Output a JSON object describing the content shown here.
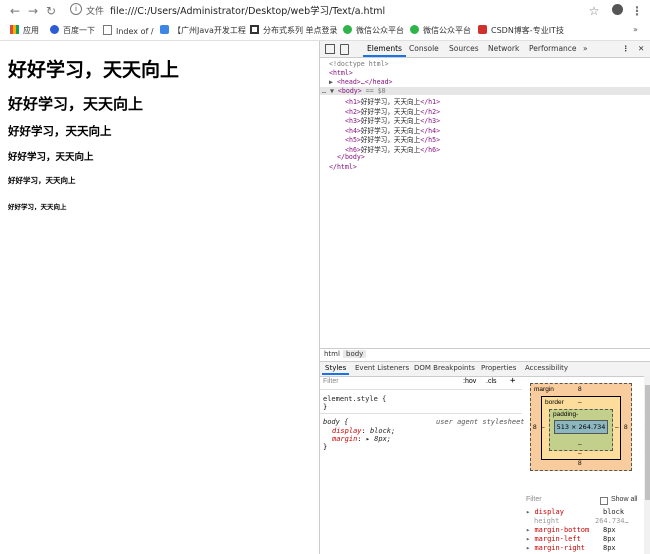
{
  "browser": {
    "url_prefix": "文件",
    "url": "file:///C:/Users/Administrator/Desktop/web学习/Text/a.html"
  },
  "bookmarks": [
    {
      "label": "应用",
      "icon": "apps-icon",
      "color": "#e04a3f"
    },
    {
      "label": "百度一下",
      "icon": "baidu-icon",
      "color": "#2d5bd6"
    },
    {
      "label": "Index of /",
      "icon": "page-icon",
      "color": "#777777"
    },
    {
      "label": "【广州Java开发工程",
      "icon": "hand-icon",
      "color": "#3b86e6"
    },
    {
      "label": "分布式系列 单点登录",
      "icon": "cnblogs-icon",
      "color": "#333333"
    },
    {
      "label": "微信公众平台",
      "icon": "wechat-icon",
      "color": "#2fb44a"
    },
    {
      "label": "微信公众平台",
      "icon": "wechat-icon",
      "color": "#2fb44a"
    },
    {
      "label": "CSDN博客-专业IT技",
      "icon": "csdn-icon",
      "color": "#d0312d"
    }
  ],
  "page": {
    "h1": "好好学习，天天向上",
    "h2": "好好学习，天天向上",
    "h3": "好好学习，天天向上",
    "h4": "好好学习，天天向上",
    "h5": "好好学习，天天向上",
    "h6": "好好学习，天天向上"
  },
  "devtools": {
    "tabs": [
      "Elements",
      "Console",
      "Sources",
      "Network",
      "Performance"
    ],
    "more": "»",
    "dom": {
      "doctype": "<!doctype html>",
      "html_open": "<html>",
      "head": "<head>…</head>",
      "body_open": "<body>",
      "body_marker": "== $0",
      "headings": [
        {
          "open": "<h1>",
          "text": "好好学习，天天向上",
          "close": "</h1>"
        },
        {
          "open": "<h2>",
          "text": "好好学习，天天向上",
          "close": "</h2>"
        },
        {
          "open": "<h3>",
          "text": "好好学习，天天向上",
          "close": "</h3>"
        },
        {
          "open": "<h4>",
          "text": "好好学习，天天向上",
          "close": "</h4>"
        },
        {
          "open": "<h5>",
          "text": "好好学习，天天向上",
          "close": "</h5>"
        },
        {
          "open": "<h6>",
          "text": "好好学习，天天向上",
          "close": "</h6>"
        }
      ],
      "body_close": "</body>",
      "html_close": "</html>"
    },
    "breadcrumbs": [
      "html",
      "body"
    ],
    "styles_tabs": [
      "Styles",
      "Event Listeners",
      "DOM Breakpoints",
      "Properties",
      "Accessibility"
    ],
    "filter_placeholder": "Filter",
    "hov": ":hov",
    "cls": ".cls",
    "plus": "+",
    "element_style": "element.style {",
    "close_brace": "}",
    "body_rule": {
      "selector": "body {",
      "source": "user agent stylesheet",
      "props": [
        {
          "name": "display",
          "value": "block;"
        },
        {
          "name": "margin",
          "value": "▸ 8px;"
        }
      ]
    },
    "box_model": {
      "margin_label": "margin",
      "margin_value": "8",
      "border_label": "border",
      "border_value": "–",
      "padding_label": "padding-",
      "padding_value": "–",
      "content": "513 × 264.734",
      "side_left": "8",
      "side_right": "8",
      "inner_left": "–",
      "inner_right": "–",
      "bottom_margin": "8",
      "bottom_border": "–"
    },
    "computed": {
      "filter": "Filter",
      "show_all": "Show all",
      "rows": [
        {
          "prop": "display",
          "value": "block",
          "dim": false
        },
        {
          "prop": "height",
          "value": "264.734…",
          "dim": true
        },
        {
          "prop": "margin-bottom",
          "value": "8px",
          "dim": false
        },
        {
          "prop": "margin-left",
          "value": "8px",
          "dim": false
        },
        {
          "prop": "margin-right",
          "value": "8px",
          "dim": false
        }
      ]
    }
  }
}
